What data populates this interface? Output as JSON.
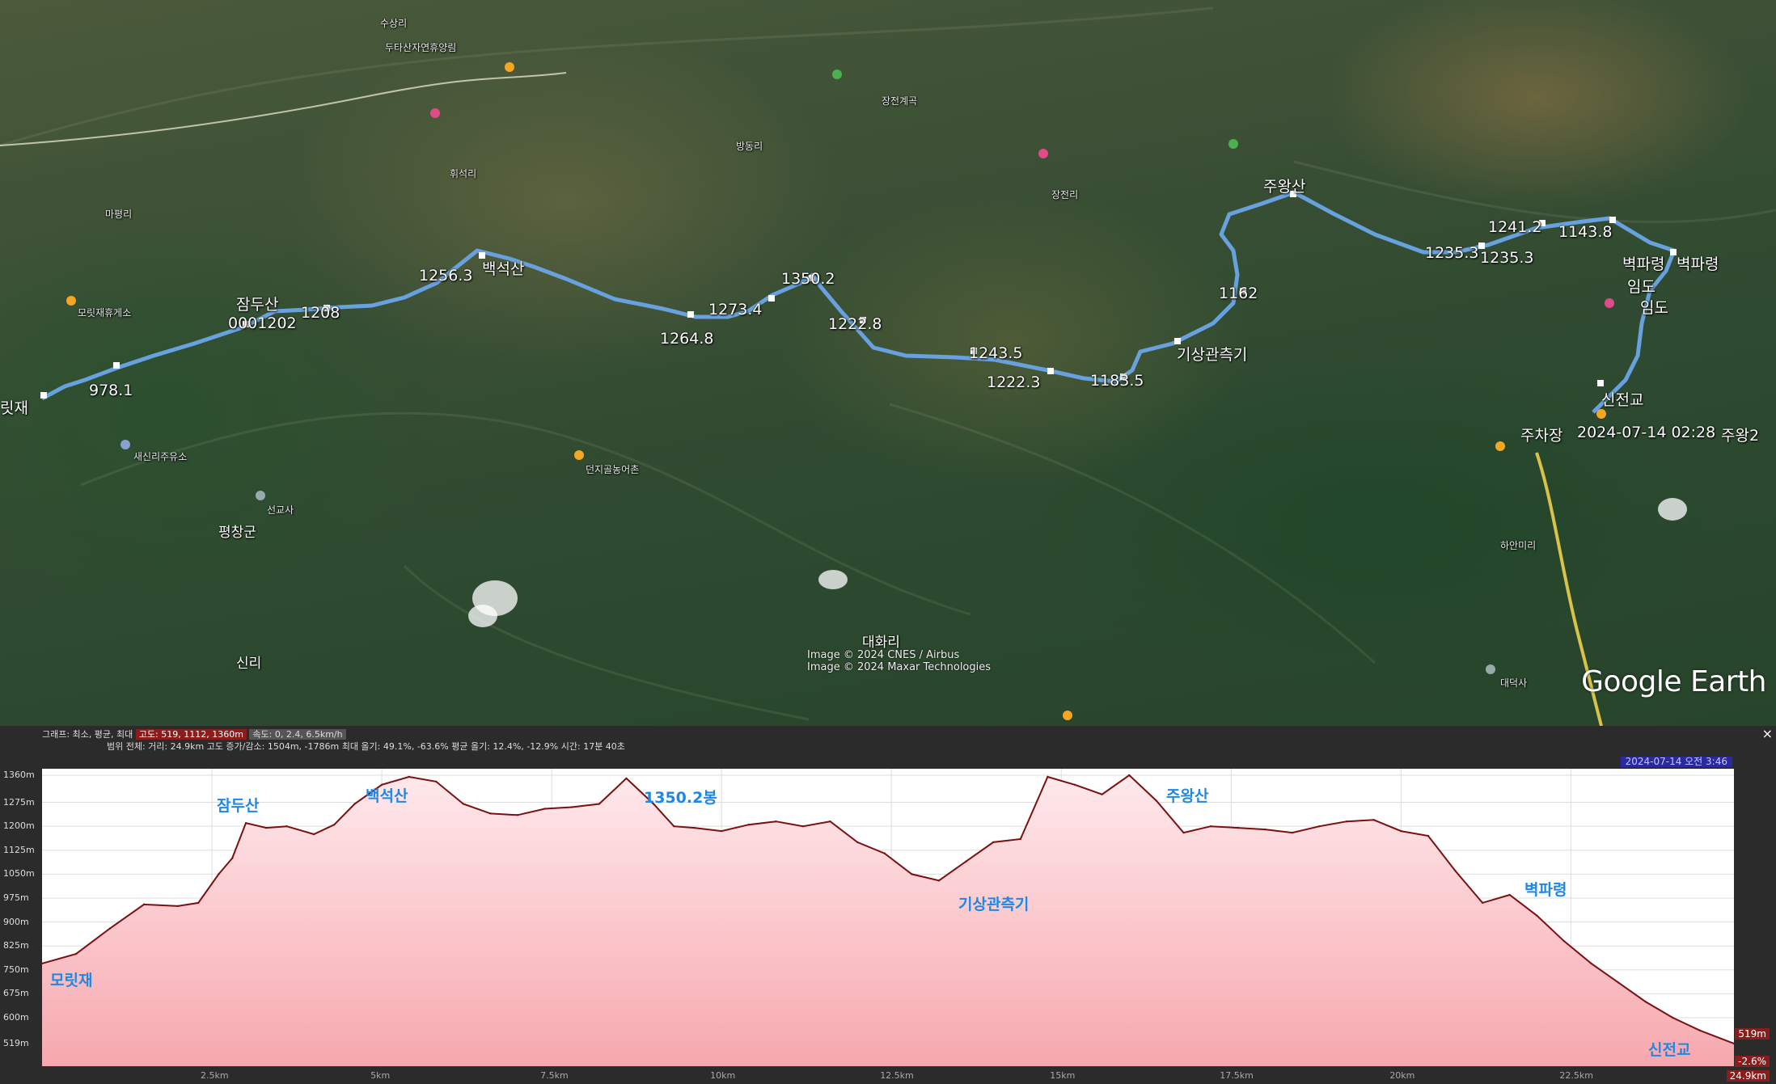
{
  "map": {
    "labels": {
      "moritjae": "릿재",
      "jamdusan": "잠두산",
      "code": "0001202",
      "e978": "978.1",
      "e1208": "1208",
      "e1256": "1256.3",
      "baekseoksan": "백석산",
      "e1264": "1264.8",
      "e1273": "1273.4",
      "e1350": "1350.2",
      "e1222a": "1222.8",
      "e1243": "1243.5",
      "e1222b": "1222.3",
      "e1183": "1183.5",
      "gisang": "기상관측기",
      "e1162": "1162",
      "juwangsan": "주왕산",
      "e1235a": "1235.3",
      "e1235b": "1235.3",
      "e1241": "1241.2",
      "e1143": "1143.8",
      "byeokparyeong1": "벽파령",
      "byeokparyeong2": "벽파령",
      "imdo1": "임도",
      "imdo2": "임도",
      "sinjeongyo": "신전교",
      "parking": "주차장",
      "timestamp": "2024-07-14 02:28",
      "juwang2": "주왕2",
      "pyeongchang": "평창군",
      "daehwari": "대화리",
      "ajeongri": "신리",
      "saesinri": "새신리주유소",
      "hamiri": "하안미리",
      "daedeoksa": "대덕사",
      "seongeuma": "선교사",
      "moritjae_rest": "모릿재휴게소",
      "dongsan": "던지골농어촌",
      "maphyeongri": "마평리",
      "hwiseokri": "휘석리",
      "bangdongri": "방동리",
      "jangjeonri": "장전리",
      "upper1": "수상리",
      "upper2": "두타산자연휴양림",
      "upper3": "장전계곡"
    },
    "credits": [
      "Image © 2024 CNES / Airbus",
      "Image © 2024 Maxar Technologies"
    ],
    "logo": "Google Earth"
  },
  "panel": {
    "stats_line1_prefix": "그래프: 최소, 평균, 최대",
    "stats_line1_elev": "고도: 519, 1112, 1360m",
    "stats_line1_speed": "속도: 0, 2.4, 6.5km/h",
    "stats_line2": "범위 전체: 거리: 24.9km 고도 증가/감소: 1504m, -1786m 최대 올기: 49.1%, -63.6% 평균 올기: 12.4%, -12.9% 시간: 17분 40초",
    "timestamp": "2024-07-14 오전 3:46",
    "close": "×",
    "y_ticks": [
      "1360m",
      "1275m",
      "1200m",
      "1125m",
      "1050m",
      "975m",
      "900m",
      "825m",
      "750m",
      "675m",
      "600m",
      "519m"
    ],
    "x_ticks": [
      "2.5km",
      "5km",
      "7.5km",
      "10km",
      "12.5km",
      "15km",
      "17.5km",
      "20km",
      "22.5km"
    ],
    "end_elev": "519m",
    "end_grade": "-2.6%",
    "end_dist": "24.9km",
    "peaks": {
      "moritjae": "모릿재",
      "jamdusan": "잠두산",
      "baekseoksan": "백석산",
      "p1350": "1350.2봉",
      "gisang": "기상관측기",
      "juwangsan": "주왕산",
      "byeokparyeong": "벽파령",
      "sinjeongyo": "신전교"
    }
  },
  "chart_data": {
    "type": "area",
    "title": "",
    "xlabel": "",
    "ylabel": "",
    "x_unit": "km",
    "y_unit": "m",
    "xlim": [
      0,
      24.9
    ],
    "ylim": [
      519,
      1360
    ],
    "x": [
      0,
      0.5,
      1.0,
      1.5,
      2.0,
      2.3,
      2.6,
      2.8,
      3.0,
      3.3,
      3.6,
      4.0,
      4.3,
      4.6,
      5.0,
      5.4,
      5.8,
      6.2,
      6.6,
      7.0,
      7.4,
      7.8,
      8.2,
      8.6,
      9.0,
      9.3,
      9.6,
      10.0,
      10.4,
      10.8,
      11.2,
      11.6,
      12.0,
      12.4,
      12.8,
      13.2,
      13.6,
      14.0,
      14.4,
      14.8,
      15.2,
      15.6,
      16.0,
      16.4,
      16.8,
      17.2,
      17.6,
      18.0,
      18.4,
      18.8,
      19.2,
      19.6,
      20.0,
      20.4,
      20.8,
      21.2,
      21.6,
      22.0,
      22.4,
      22.8,
      23.2,
      23.6,
      24.0,
      24.4,
      24.9
    ],
    "series": [
      {
        "values": [
          770,
          800,
          880,
          955,
          950,
          960,
          1050,
          1100,
          1210,
          1195,
          1200,
          1175,
          1205,
          1270,
          1330,
          1355,
          1340,
          1270,
          1240,
          1235,
          1255,
          1260,
          1270,
          1350,
          1270,
          1200,
          1195,
          1185,
          1205,
          1215,
          1200,
          1215,
          1150,
          1115,
          1050,
          1030,
          1090,
          1150,
          1160,
          1355,
          1330,
          1300,
          1360,
          1280,
          1180,
          1200,
          1195,
          1190,
          1180,
          1200,
          1215,
          1220,
          1185,
          1170,
          1060,
          960,
          985,
          920,
          840,
          770,
          710,
          650,
          600,
          560,
          519
        ]
      }
    ]
  }
}
